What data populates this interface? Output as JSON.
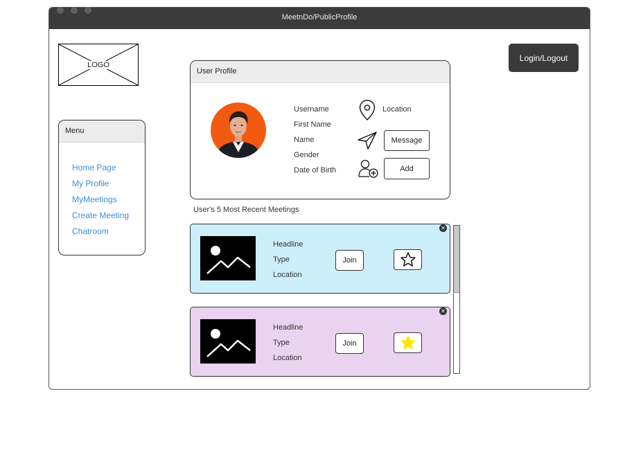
{
  "window": {
    "title": "MeetnDo/PublicProfile"
  },
  "logo": {
    "label": "LOGO"
  },
  "header": {
    "login_label": "Login/Logout"
  },
  "menu": {
    "title": "Menu",
    "items": [
      "Home Page",
      "My Profile",
      "MyMeetings",
      "Create Meeting",
      "Chatroom"
    ]
  },
  "profile": {
    "title": "User Profile",
    "fields": [
      "Username",
      "First Name",
      "Name",
      "Gender",
      "Date of Birth"
    ],
    "location_label": "Location",
    "message_label": "Message",
    "add_label": "Add"
  },
  "recent": {
    "title": "User's 5 Most Recent Meetings",
    "meetings": [
      {
        "headline": "Headline",
        "type": "Type",
        "location": "Location",
        "join_label": "Join",
        "favorited": false,
        "bg": "#cdeefb"
      },
      {
        "headline": "Headline",
        "type": "Type",
        "location": "Location",
        "join_label": "Join",
        "favorited": true,
        "bg": "#ead3ef"
      }
    ]
  },
  "colors": {
    "link": "#3a8fd6",
    "titlebar": "#3b3b3b",
    "avatar_bg": "#f25a12",
    "star_fill": "#ffe600"
  }
}
